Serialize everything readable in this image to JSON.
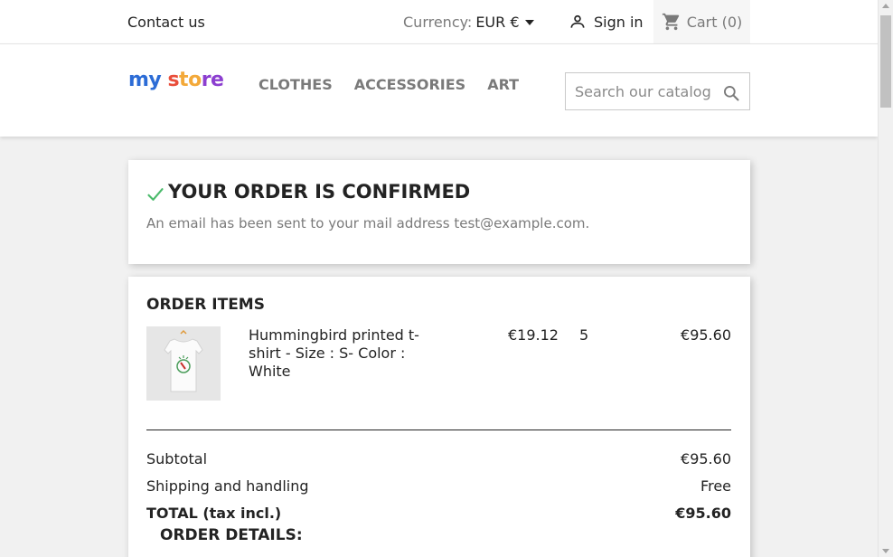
{
  "topbar": {
    "contact": "Contact us",
    "currency_label": "Currency:",
    "currency_value": "EUR €",
    "signin": "Sign in",
    "cart": "Cart (0)"
  },
  "header": {
    "logo": {
      "part1": "my",
      "part2": "s",
      "part3": "to",
      "part4": "re"
    },
    "menu": [
      "Clothes",
      "Accessories",
      "Art"
    ],
    "search_placeholder": "Search our catalog"
  },
  "confirmation": {
    "title": "YOUR ORDER IS CONFIRMED",
    "message": "An email has been sent to your mail address test@example.com."
  },
  "order_items": {
    "title": "ORDER ITEMS",
    "items": [
      {
        "name": "Hummingbird printed t-shirt - Size : S- Color : White",
        "unit_price": "€19.12",
        "quantity": "5",
        "total": "€95.60"
      }
    ],
    "summary": [
      {
        "label": "Subtotal",
        "value": "€95.60"
      },
      {
        "label": "Shipping and handling",
        "value": "Free"
      },
      {
        "label": "TOTAL (tax incl.)",
        "value": "€95.60"
      }
    ],
    "details_title": "ORDER DETAILS:"
  },
  "colors": {
    "accent_check": "#4cbb6c",
    "text_dark": "#232323",
    "text_muted": "#7a7a7a"
  }
}
